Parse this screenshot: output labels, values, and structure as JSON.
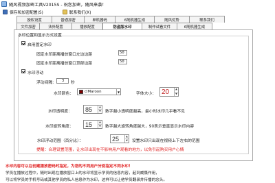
{
  "window": {
    "title": "随风视频加密工具V2015S - 祝您加密，随风来袭！"
  },
  "toolbar": {
    "save_label": "保存和加密配置(S)",
    "contact_label": "联系我们(X)"
  },
  "tabs": {
    "row1": [
      "授权设置",
      "普通加密",
      "单机器码",
      "6随机器生成",
      "随风优势",
      "联系我们"
    ],
    "row2": [
      "文件加密",
      "法外配置",
      "播放配置",
      "防盗版水印",
      "制作试看文件",
      "6随机器生成"
    ],
    "active": "防盗版水印"
  },
  "group": {
    "title": "水印位置和显示方式设置"
  },
  "fixed_watermark": {
    "checkbox_label": "启用固定水印",
    "left_label": "固定水印距离播放窗口左边边距",
    "left_value": "50",
    "top_label": "固定水印距离播放窗口顶部边距",
    "top_value": "50"
  },
  "float_watermark": {
    "checkbox_label": "水印浮动",
    "interval_label": "浮动间隔:",
    "interval_value": "3",
    "interval_unit": "秒"
  },
  "color": {
    "label": "水印颜色：",
    "value": "clMaroon",
    "swatch": "#800000"
  },
  "font_size": {
    "label": "字体大小：",
    "value": "20"
  },
  "transparency": {
    "label": "水印透明度：",
    "value": "85",
    "desc": "数字越小透明度越高，最小时水印几乎看不见"
  },
  "rotation": {
    "label": "水印旋转角度：",
    "value": "15",
    "desc": "数字越大旋转角度越大，90表示垂直显示水印内容"
  },
  "float_range": {
    "label": "水印浮动范围（百分比）：",
    "value": "25",
    "desc": "设置水印只出现在视频上下左右的范围"
  },
  "tip": "提醒：合理设置范围，让水印出现在不影响用户观看的地方，以免引起购买用户心情",
  "footer": {
    "line1": "水印内容可以在创建播放密码时指定，为您的不同用户分别指定不同水印！",
    "line2": "学员在播放过程中，随时出现在播放窗口上的水印将显示学员的信息内容，起到威慑作用，",
    "line3": "可以将学员的手机号码或其他学员的私人信息作为水印，这样可以让他学员翻录并传播的念头。"
  }
}
